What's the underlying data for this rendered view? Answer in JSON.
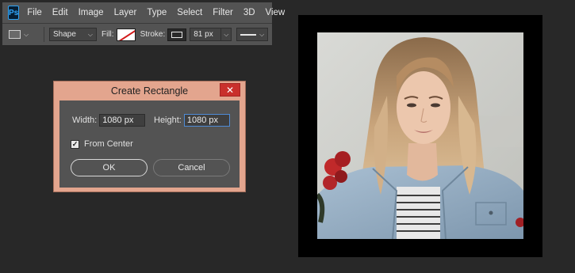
{
  "menubar": {
    "logo": "Ps",
    "items": [
      "File",
      "Edit",
      "Image",
      "Layer",
      "Type",
      "Select",
      "Filter",
      "3D",
      "View"
    ]
  },
  "options": {
    "mode": "Shape",
    "fill_label": "Fill:",
    "stroke_label": "Stroke:",
    "stroke_width": "81 px"
  },
  "dialog": {
    "title": "Create Rectangle",
    "close_glyph": "✕",
    "width_label": "Width:",
    "width_value": "1080 px",
    "height_label": "Height:",
    "height_value": "1080 px",
    "from_center_label": "From Center",
    "from_center_checked": true,
    "ok_label": "OK",
    "cancel_label": "Cancel"
  },
  "colors": {
    "dialog_frame": "#e3a58e",
    "close_button": "#c9302c",
    "app_background": "#282828"
  },
  "icons": {
    "logo": "photoshop-logo",
    "fill": "no-fill-swatch",
    "stroke": "stroke-swatch",
    "close": "close-icon",
    "checkbox": "checkmark-icon"
  }
}
